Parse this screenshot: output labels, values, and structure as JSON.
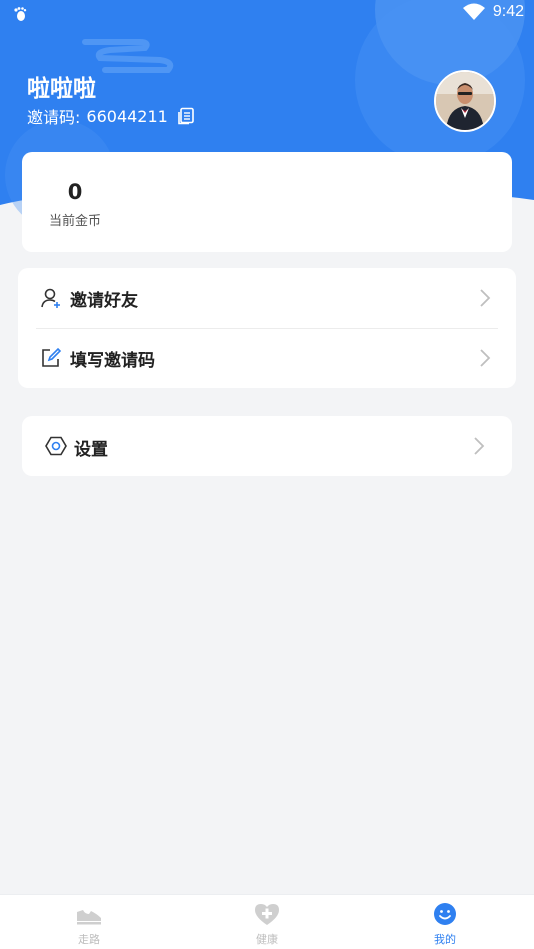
{
  "status_bar": {
    "time": "9:42",
    "left_icon": "footprint-icon",
    "wifi_icon": "wifi-icon"
  },
  "profile": {
    "username": "啦啦啦",
    "invite_label": "邀请码:",
    "invite_code": "66044211",
    "copy_icon": "copy-icon"
  },
  "coins": {
    "value": "0",
    "label": "当前金币"
  },
  "menu": {
    "items": [
      {
        "label": "邀请好友",
        "icon": "add-user-icon"
      },
      {
        "label": "填写邀请码",
        "icon": "edit-icon"
      }
    ]
  },
  "settings": {
    "label": "设置",
    "icon": "hexagon-settings-icon"
  },
  "tabbar": {
    "tabs": [
      {
        "label": "走路",
        "icon": "shoe-icon",
        "active": false
      },
      {
        "label": "健康",
        "icon": "heart-plus-icon",
        "active": false
      },
      {
        "label": "我的",
        "icon": "smile-icon",
        "active": true
      }
    ]
  },
  "colors": {
    "primary": "#2f80f0",
    "background": "#f3f4f6",
    "card": "#ffffff",
    "text": "#222222",
    "tab_inactive": "#bdbdbd"
  }
}
